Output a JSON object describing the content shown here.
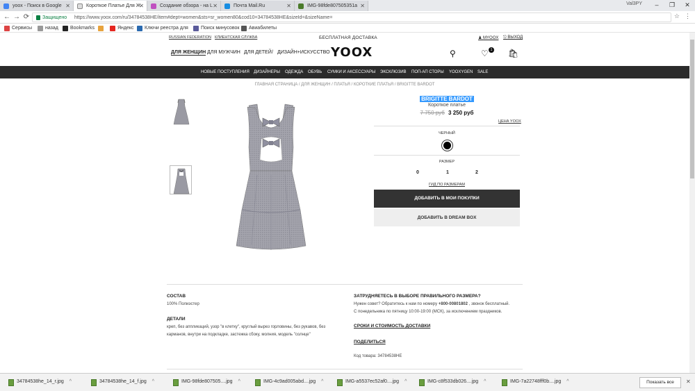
{
  "browser": {
    "tabs": [
      {
        "label": "yoox - Поиск в Google",
        "color": "#4285f4"
      },
      {
        "label": "Короткое Платье Для Ж",
        "color": "#888888"
      },
      {
        "label": "Создание обзора - на L",
        "color": "#c050c0"
      },
      {
        "label": "Почта Mail.Ru",
        "color": "#168de2"
      },
      {
        "label": "IMG-98fde807505351a",
        "color": "#4a7a2a"
      }
    ],
    "user": "Val3PY",
    "secure_label": "Защищено",
    "url": "https://www.yoox.com/ru/34784538HE/item#dept=women&sts=sr_women80&cod10=34784538HE&sizeId=&sizeName=",
    "bookmarks": [
      {
        "label": "Сервисы",
        "color": "#d44"
      },
      {
        "label": "назад",
        "color": "#999"
      },
      {
        "label": "Bookmarks",
        "color": "#222"
      },
      {
        "label": "",
        "color": "#e8a33d"
      },
      {
        "label": "Яндекс",
        "color": "#e52620"
      },
      {
        "label": "Ключи реестра для",
        "color": "#2a6ab0"
      },
      {
        "label": "Поиск минусовок",
        "color": "#5a5a9a"
      },
      {
        "label": "Авиабилеты",
        "color": "#555"
      }
    ]
  },
  "site": {
    "top_links": {
      "country": "RUSSIAN FEDERATION",
      "service": "КЛИЕНТСКАЯ СЛУЖБА",
      "free_shipping": "БЕСПЛАТНАЯ ДОСТАВКА",
      "my_yoox": "MYOOX",
      "logout": "ВЫХОД"
    },
    "gender_nav": [
      "ДЛЯ ЖЕНЩИН",
      "ДЛЯ МУЖЧИН",
      "ДЛЯ ДЕТЕЙ",
      "/",
      "ДИЗАЙН+ИСКУССТВО"
    ],
    "logo": "YOOX",
    "wishlist_count": "1",
    "categories": [
      "НОВЫЕ ПОСТУПЛЕНИЯ",
      "ДИЗАЙНЕРЫ",
      "ОДЕЖДА",
      "ОБУВЬ",
      "СУМКИ И АКСЕССУАРЫ",
      "ЭКСКЛЮЗИВ",
      "ПОП-АП СТОРЫ",
      "YOOXYGEN",
      "SALE"
    ],
    "breadcrumb": "ГЛАВНАЯ СТРАНИЦА / ДЛЯ ЖЕНЩИН / ПЛАТЬЯ / КОРОТКИЕ ПЛАТЬЯ / BRIGITTE BARDOT"
  },
  "product": {
    "brand": "BRIGITTE BARDOT",
    "name": "Короткое платье",
    "price_old": "7 750 руб",
    "price_new": "3 250 руб",
    "price_label": "ЦЕНА YOOX",
    "color_label": "ЧЕРНЫЙ",
    "color_hex": "#000000",
    "size_label": "РАЗМЕР",
    "sizes": [
      "0",
      "1",
      "2"
    ],
    "size_guide": "ГИД ПО РАЗМЕРАМ",
    "buy_button": "ДОБАВИТЬ В МОИ ПОКУПКИ",
    "dream_button": "ДОБАВИТЬ В DREAM BOX"
  },
  "details": {
    "composition_title": "СОСТАВ",
    "composition": "100% Полиэстер",
    "details_title": "ДЕТАЛИ",
    "details_line1": "креп, без аппликаций, узор \"в клетку\", круглый вырез горловины, без рукавов, без",
    "details_line2": "карманов, внутри на подкладке, застежка сбоку, молния, модель \"солнце\"",
    "help_title": "ЗАТРУДНЯЕТЕСЬ В ВЫБОРЕ ПРАВИЛЬНОГО РАЗМЕРА?",
    "help_line1_pre": "Нужен совет? Обратитесь к нам по номеру ",
    "help_phone": "+800-00801802",
    "help_line1_post": " , звонок бесплатный.",
    "help_line2": "С понедельника по пятницу 10:00-19:00 (МСК), за исключением праздников.",
    "shipping_link": "СРОКИ И СТОИМОСТЬ ДОСТАВКИ",
    "share_link": "ПОДЕЛИТЬСЯ",
    "code": "Код товара: 34784538HE"
  },
  "downloads": {
    "files": [
      "34784538he_14_r.jpg",
      "34784538he_14_f.jpg",
      "IMG-98fde807505....jpg",
      "IMG-4c9ad005abd....jpg",
      "IMG-a5537ec52af0....jpg",
      "IMG-c8f533db026....jpg",
      "IMG-7a22748fff0b....jpg"
    ],
    "show_all": "Показать все"
  }
}
